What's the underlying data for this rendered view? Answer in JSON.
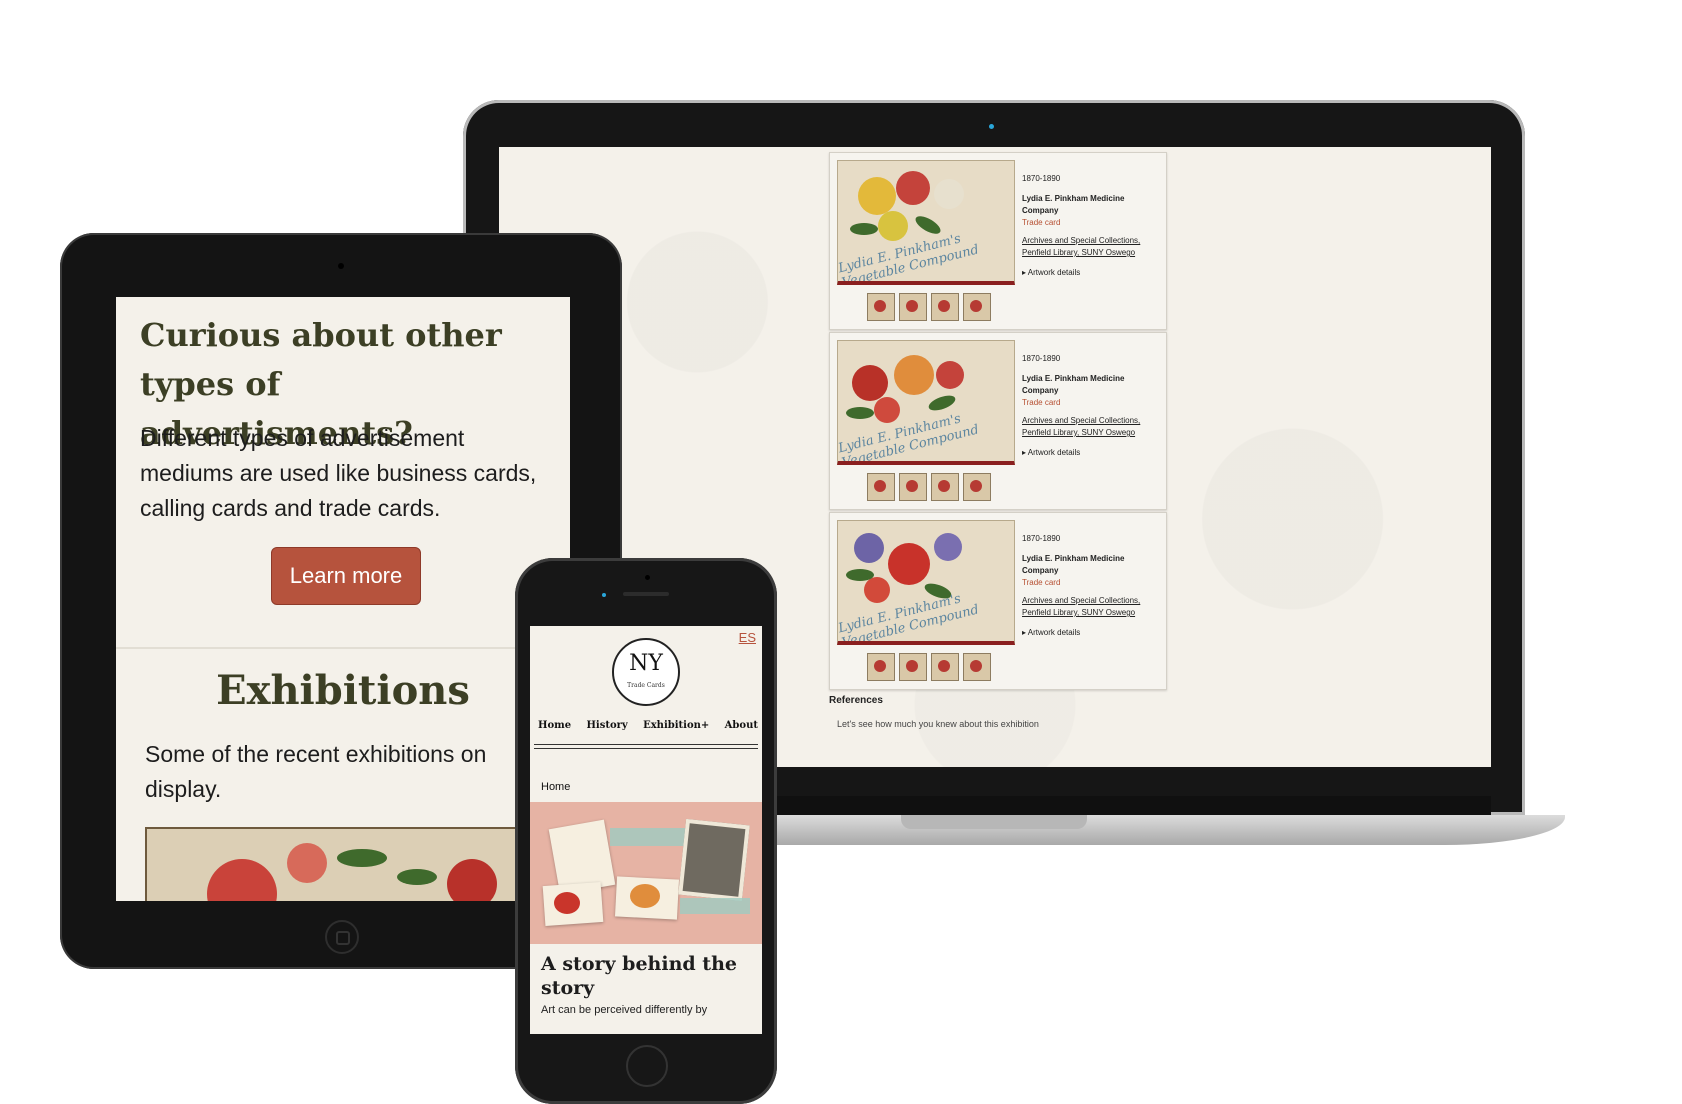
{
  "laptop": {
    "cards": [
      {
        "date": "1870-1890",
        "maker": "Lydia E. Pinkham Medicine Company",
        "type": "Trade card",
        "source": "Archives and Special Collections, Penfield Library, SUNY Oswego",
        "details": "Artwork details",
        "image_script": "Lydia E. Pinkham's Vegetable Compound"
      },
      {
        "date": "1870-1890",
        "maker": "Lydia E. Pinkham Medicine Company",
        "type": "Trade card",
        "source": "Archives and Special Collections, Penfield Library, SUNY Oswego",
        "details": "Artwork details",
        "image_script": "Lydia E. Pinkham's Vegetable Compound"
      },
      {
        "date": "1870-1890",
        "maker": "Lydia E. Pinkham Medicine Company",
        "type": "Trade card",
        "source": "Archives and Special Collections, Penfield Library, SUNY Oswego",
        "details": "Artwork details",
        "image_script": "Lydia E. Pinkham's Vegetable Compound"
      }
    ],
    "references_label": "References",
    "references_sub": "Let's see how much you knew about this exhibition"
  },
  "tablet": {
    "heading": "Curious about other types of advertisments?",
    "body": "Different types of advertisement mediums are used like business cards, calling cards and trade cards.",
    "button": "Learn more",
    "exhibitions_heading": "Exhibitions",
    "exhibitions_body": "Some of the recent exhibitions on display."
  },
  "phone": {
    "lang": "ES",
    "logo_big": "NY",
    "logo_small": "Trade Cards",
    "nav": [
      "Home",
      "History",
      "Exhibition+",
      "About"
    ],
    "breadcrumb": "Home",
    "story_title": "A story behind the story",
    "story_body": "Art can be perceived differently by"
  },
  "colors": {
    "accent": "#b6533d",
    "heading": "#3c3f25",
    "page_bg": "#f4f1ea"
  }
}
